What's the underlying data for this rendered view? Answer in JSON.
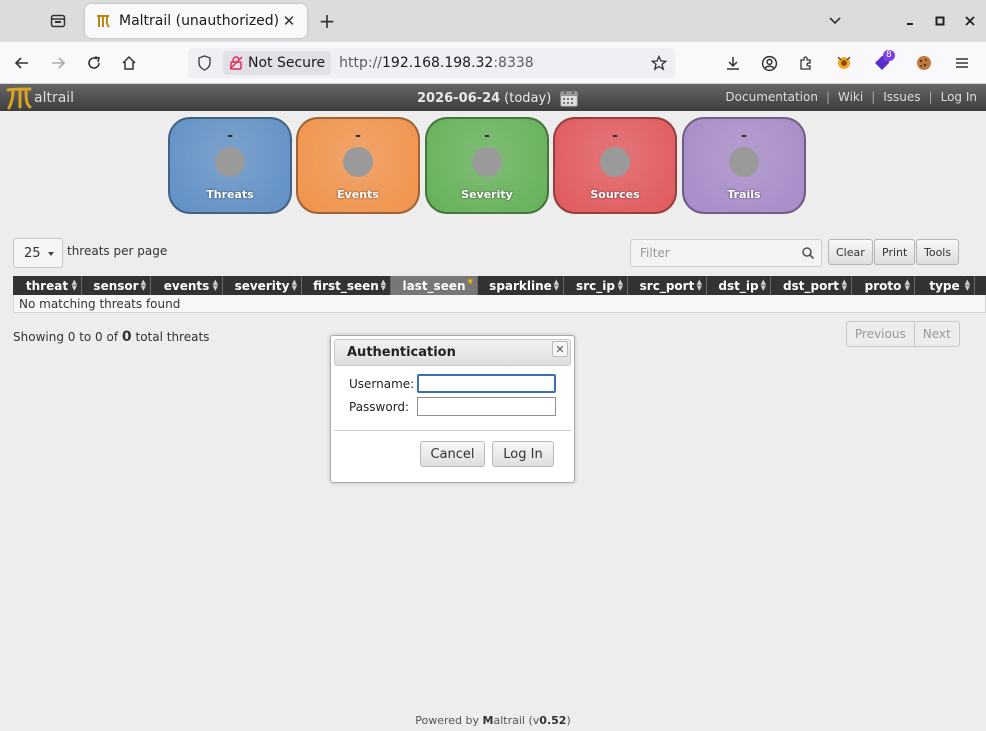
{
  "browser": {
    "tab_title": "Maltrail (unauthorized)",
    "not_secure_label": "Not Secure",
    "url_scheme": "http://",
    "url_host": "192.168.198.32",
    "url_port": ":8338",
    "extension_badge": "8"
  },
  "header": {
    "logo_text": "altrail",
    "date": "2026-06-24",
    "date_suffix": "(today)",
    "links": [
      "Documentation",
      "Wiki",
      "Issues",
      "Log In"
    ]
  },
  "stats": [
    {
      "label": "Threats",
      "value": "-",
      "color": "#5f8fc4"
    },
    {
      "label": "Events",
      "value": "-",
      "color": "#f0924a"
    },
    {
      "label": "Severity",
      "value": "-",
      "color": "#64b058"
    },
    {
      "label": "Sources",
      "value": "-",
      "color": "#e0585b"
    },
    {
      "label": "Trails",
      "value": "-",
      "color": "#a68ac8"
    }
  ],
  "controls": {
    "per_page_value": "25",
    "per_page_label": "threats per page",
    "filter_placeholder": "Filter",
    "buttons": [
      "Clear",
      "Print",
      "Tools"
    ]
  },
  "table": {
    "columns": [
      "threat",
      "sensor",
      "events",
      "severity",
      "first_seen",
      "last_seen",
      "sparkline",
      "src_ip",
      "src_port",
      "dst_ip",
      "dst_port",
      "proto",
      "type",
      "t"
    ],
    "empty_message": "No matching threats found"
  },
  "status": {
    "showing_prefix": "Showing 0 to 0 of",
    "total": "0",
    "showing_suffix": "total threats",
    "prev": "Previous",
    "next": "Next"
  },
  "auth_dialog": {
    "title": "Authentication",
    "username_label": "Username:",
    "password_label": "Password:",
    "username_value": "",
    "password_value": "",
    "cancel": "Cancel",
    "login": "Log In"
  },
  "footer": {
    "prefix": "Powered by",
    "brand_m": "M",
    "brand_rest": "altrail",
    "version_prefix": "(v",
    "version": "0.52",
    "version_suffix": ")"
  }
}
